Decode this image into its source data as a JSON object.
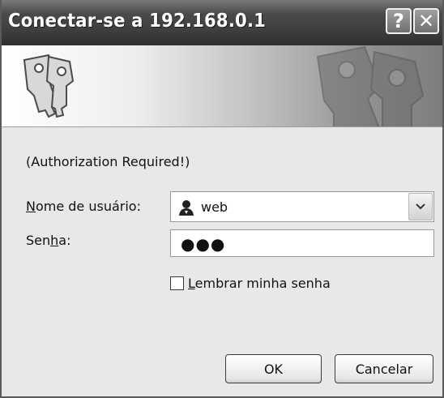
{
  "window": {
    "title": "Conectar-se a 192.168.0.1",
    "help_glyph": "?",
    "close_glyph": "✕"
  },
  "banner": {
    "icon": "keys-icon"
  },
  "form": {
    "message": "(Authorization Required!)",
    "username_label_mnemonic": "N",
    "username_label_rest": "ome de usuário:",
    "username_value": "web",
    "username_icon": "user-icon",
    "password_label_pre": "Sen",
    "password_label_mnemonic": "h",
    "password_label_post": "a:",
    "password_mask": "●●●",
    "remember_mnemonic": "L",
    "remember_rest": "embrar minha senha",
    "remember_checked": false
  },
  "buttons": {
    "ok": "OK",
    "cancel": "Cancelar"
  }
}
